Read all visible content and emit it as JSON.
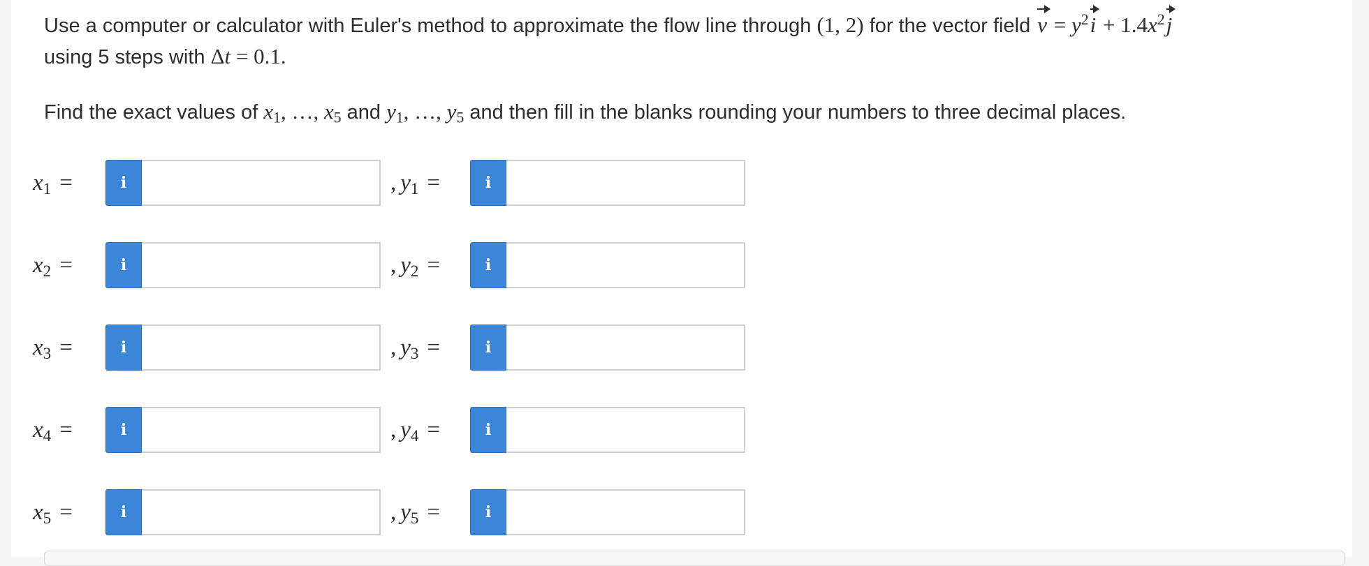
{
  "question": {
    "intro": "Use a computer or calculator with Euler's method to approximate the flow line through ",
    "point": "(1, 2)",
    "for_text": " for the vector field ",
    "vec_v": "v",
    "equals": " = ",
    "y_var": "y",
    "exp2": "2",
    "vec_i": "i",
    "plus": " + 1.4",
    "x_var": "x",
    "vec_j": "j",
    "line2_prefix": "using 5 steps with ",
    "delta": "Δ",
    "t_var": "t",
    "step_value": " = 0.1."
  },
  "instruction": {
    "prefix": "Find the exact values of ",
    "x_seq": "x",
    "sub1": "1",
    "ellipsis": ", …, ",
    "sub5": "5",
    "and": " and ",
    "y_seq": "y",
    "suffix": " and then fill in the blanks rounding your numbers to three decimal places."
  },
  "rows": [
    {
      "x_label": "x",
      "y_label": "y",
      "sub": "1",
      "eq": "=",
      "comma": ",",
      "x_value": "",
      "y_value": ""
    },
    {
      "x_label": "x",
      "y_label": "y",
      "sub": "2",
      "eq": "=",
      "comma": ",",
      "x_value": "",
      "y_value": ""
    },
    {
      "x_label": "x",
      "y_label": "y",
      "sub": "3",
      "eq": "=",
      "comma": ",",
      "x_value": "",
      "y_value": ""
    },
    {
      "x_label": "x",
      "y_label": "y",
      "sub": "4",
      "eq": "=",
      "comma": ",",
      "x_value": "",
      "y_value": ""
    },
    {
      "x_label": "x",
      "y_label": "y",
      "sub": "5",
      "eq": "=",
      "comma": ",",
      "x_value": "",
      "y_value": ""
    }
  ],
  "info_icon": {
    "glyph": "i",
    "name": "info-icon"
  },
  "colors": {
    "info_button": "#3b86d9",
    "input_border": "#cfcfcf",
    "text": "#2d2d2d"
  }
}
